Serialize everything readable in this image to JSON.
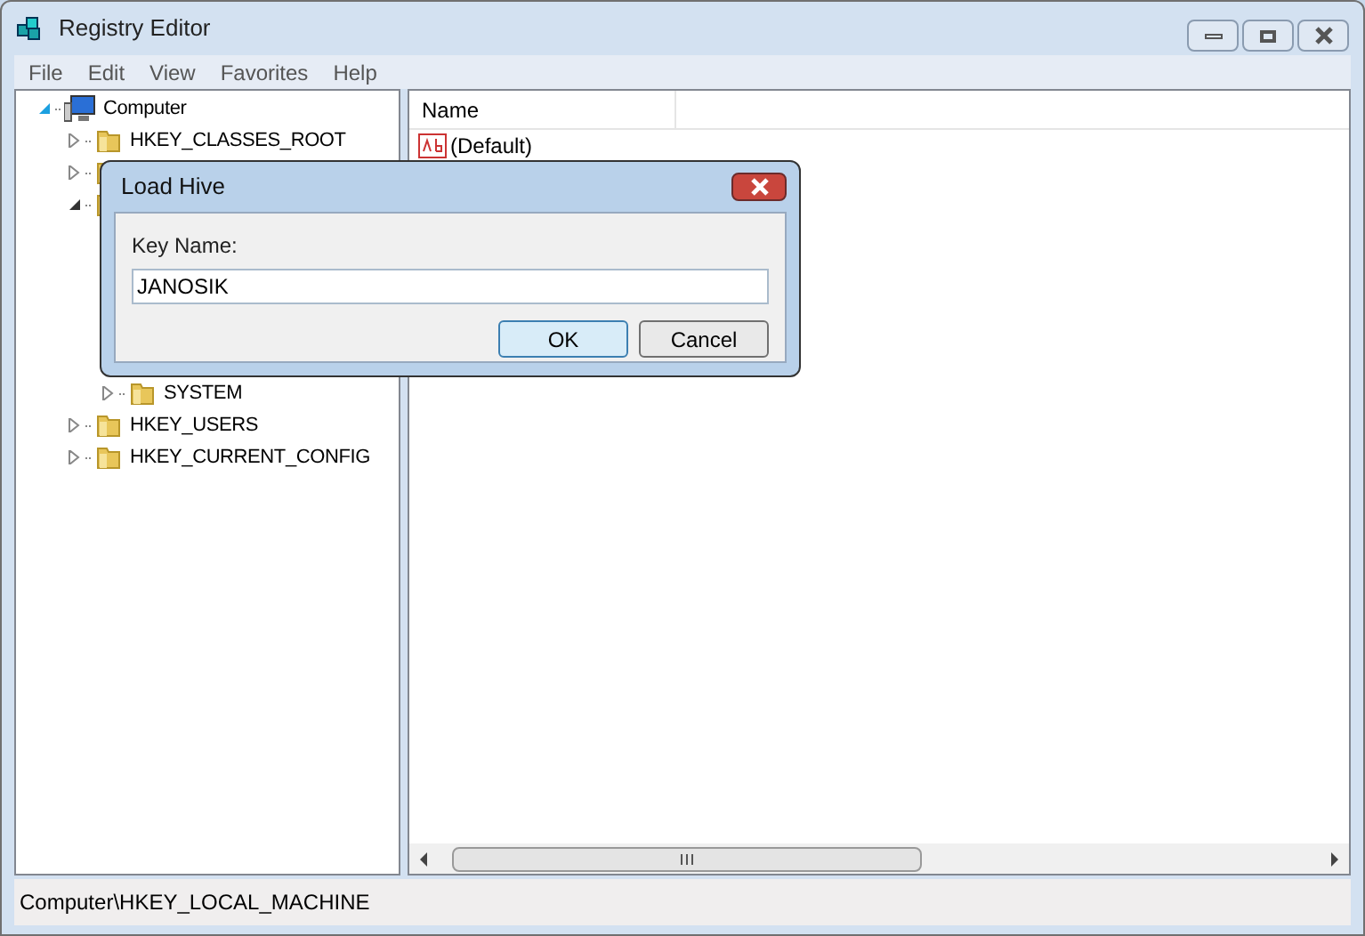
{
  "window": {
    "title": "Registry Editor"
  },
  "menu": [
    "File",
    "Edit",
    "View",
    "Favorites",
    "Help"
  ],
  "tree": [
    {
      "label": "Computer",
      "expanded": true,
      "children": [
        {
          "label": "HKEY_CLASSES_ROOT",
          "expanded": false
        },
        {
          "expanded": false
        },
        {
          "expanded": true,
          "children": [
            {
              "label": "SYSTEM",
              "expanded": false
            }
          ]
        },
        {
          "label": "HKEY_USERS",
          "expanded": false
        },
        {
          "label": "HKEY_CURRENT_CONFIG",
          "expanded": false
        }
      ]
    }
  ],
  "values": {
    "columns": [
      "Name"
    ],
    "rows": [
      {
        "name": "(Default)"
      }
    ]
  },
  "status_bar": "Computer\\HKEY_LOCAL_MACHINE",
  "dialog": {
    "title": "Load Hive",
    "label": "Key Name:",
    "value": "JANOSIK",
    "buttons": [
      {
        "label": "OK",
        "default": true
      },
      {
        "label": "Cancel",
        "default": false
      }
    ]
  }
}
